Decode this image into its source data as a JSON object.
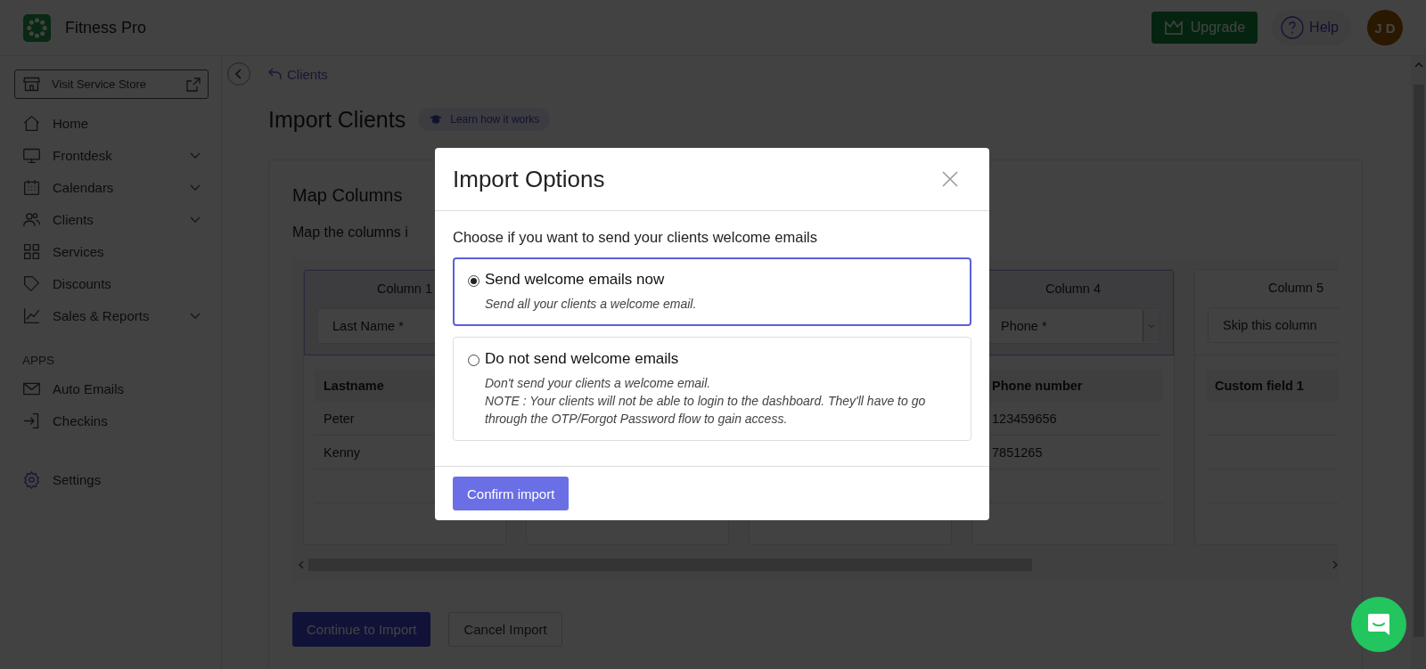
{
  "header": {
    "brand": "Fitness Pro",
    "upgrade": "Upgrade",
    "help": "Help",
    "avatar": "J D"
  },
  "sidebar": {
    "store_button": "Visit Service Store",
    "items": [
      {
        "label": "Home",
        "expandable": false
      },
      {
        "label": "Frontdesk",
        "expandable": true
      },
      {
        "label": "Calendars",
        "expandable": true
      },
      {
        "label": "Clients",
        "expandable": true
      },
      {
        "label": "Services",
        "expandable": false
      },
      {
        "label": "Discounts",
        "expandable": false
      },
      {
        "label": "Sales & Reports",
        "expandable": true
      }
    ],
    "section": "APPS",
    "apps": [
      {
        "label": "Auto Emails"
      },
      {
        "label": "Checkins"
      }
    ],
    "settings": "Settings"
  },
  "breadcrumb": "Clients",
  "page_title": "Import Clients",
  "learn_link": "Learn how it works",
  "card": {
    "title": "Map Columns",
    "description": "Map the columns i",
    "columns": [
      {
        "header": "Column 1",
        "select": "Last Name *",
        "selected": true,
        "table_header": "Lastname",
        "rows": [
          "Peter",
          "Kenny"
        ]
      },
      {},
      {},
      {
        "header": "Column 4",
        "select": "Phone *",
        "caret": true,
        "selected": true,
        "table_header": "Phone number",
        "rows": [
          "123459656",
          "7851265"
        ]
      },
      {
        "header": "Column 5",
        "select": "Skip this column",
        "selected": false,
        "table_header": "Custom field 1"
      }
    ]
  },
  "buttons": [
    {
      "label": "Continue to Import",
      "kind": "primary"
    },
    {
      "label": "Cancel Import",
      "kind": "secondary"
    }
  ],
  "modal": {
    "title": "Import Options",
    "prompt": "Choose if you want to send your clients welcome emails",
    "options": [
      {
        "label": "Send welcome emails now",
        "selected": true,
        "description": [
          "Send all your clients a welcome email."
        ]
      },
      {
        "label": "Do not send welcome emails",
        "selected": false,
        "description": [
          "Don't send your clients a welcome email.",
          "NOTE : Your clients will not be able to login to the dashboard. They'll have to go through the OTP/Forgot Password flow to gain access."
        ]
      }
    ],
    "confirm": "Confirm import"
  }
}
